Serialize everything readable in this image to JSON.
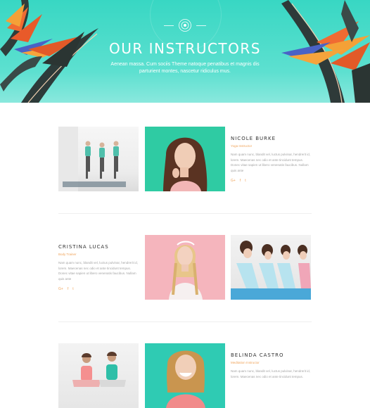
{
  "hero": {
    "title": "OUR INSTRUCTORS",
    "subtitle": "Aenean massa. Cum sociis Theme natoque penatibus et magnis dis parturient montes, nascetur ridiculus mus."
  },
  "instructors": [
    {
      "name": "NICOLE BURKE",
      "role": "Yoga Instructor",
      "bio": "Nam quam nunc, blandit vel, luctus pulvinar, hendrerit id, lorem. Maecenas nec odio et ante tincidunt tempus. Donec vitae sapien ut libero venenatis faucibus. Nullam quis ante",
      "social": [
        "G+",
        "f",
        "t"
      ]
    },
    {
      "name": "CRISTINA LUCAS",
      "role": "Body Trainer",
      "bio": "Nam quam nunc, blandit vel, luctus pulvinar, hendrerit id, lorem. Maecenas nec odio et ante tincidunt tempus. Donec vitae sapien ut libero venenatis faucibus. Nullam quis ante",
      "social": [
        "G+",
        "f",
        "t"
      ]
    },
    {
      "name": "BELINDA CASTRO",
      "role": "Meditation Instructor",
      "bio": "Nam quam nunc, blandit vel, luctus pulvinar, hendrerit id, lorem. Maecenas nec odio et ante tincidunt tempus.",
      "social": []
    }
  ],
  "colors": {
    "accent": "#f0a45b",
    "teal": "#38d7c3",
    "pink": "#f5b5bd"
  }
}
